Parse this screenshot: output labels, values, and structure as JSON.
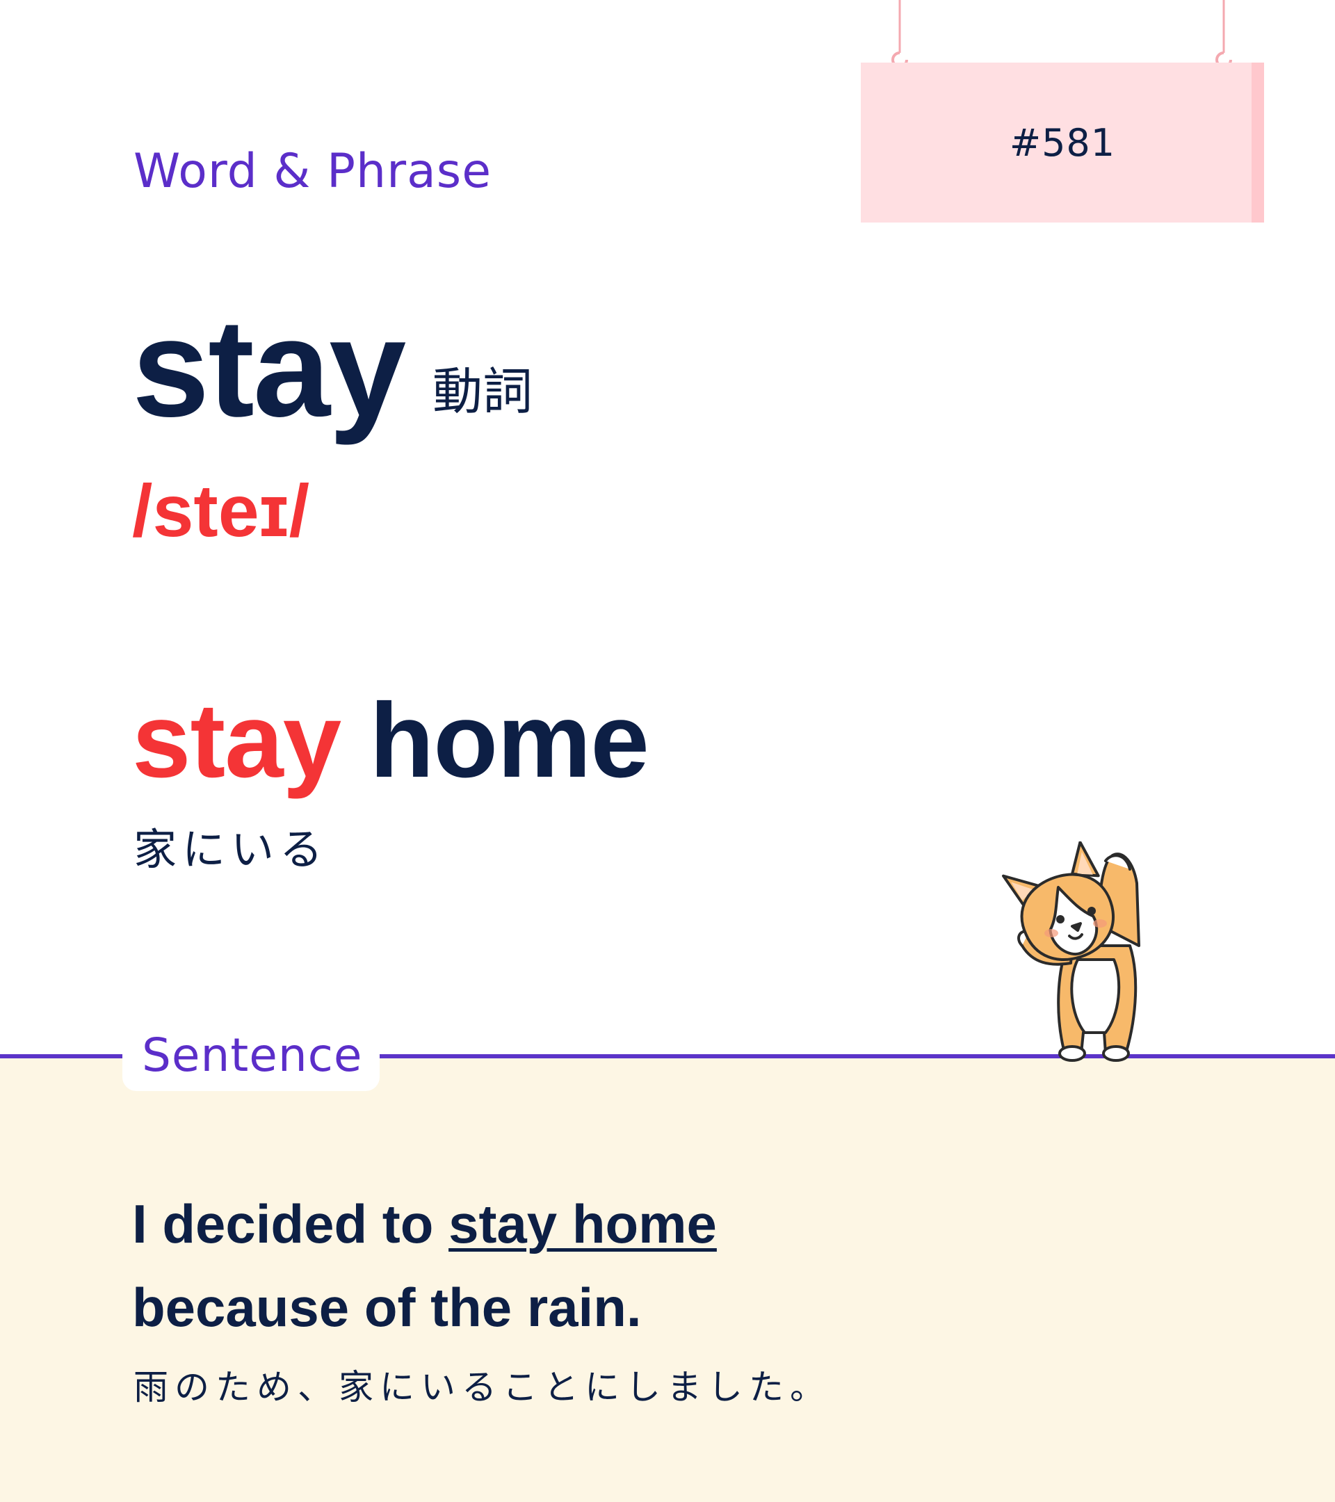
{
  "header": {
    "section_label": "Word & Phrase",
    "number": "#581"
  },
  "word": {
    "headword": "stay",
    "part_of_speech": "動詞",
    "ipa": "/steɪ/"
  },
  "phrase": {
    "highlight": "stay",
    "rest": " home",
    "translation": "家にいる"
  },
  "sentence": {
    "section_label": "Sentence",
    "line1_before": "I decided to ",
    "line1_underlined": "stay home",
    "line2": "because of the rain.",
    "translation": "雨のため、家にいることにしました。"
  },
  "colors": {
    "navy": "#0d1f45",
    "accent_red": "#f43436",
    "purple": "#5b2ec9",
    "sign_pink": "#ffdfe2",
    "cream": "#fdf6e4"
  },
  "icons": {
    "mascot": "corgi-mascot-icon",
    "sign_hooks": "hook-icon"
  }
}
